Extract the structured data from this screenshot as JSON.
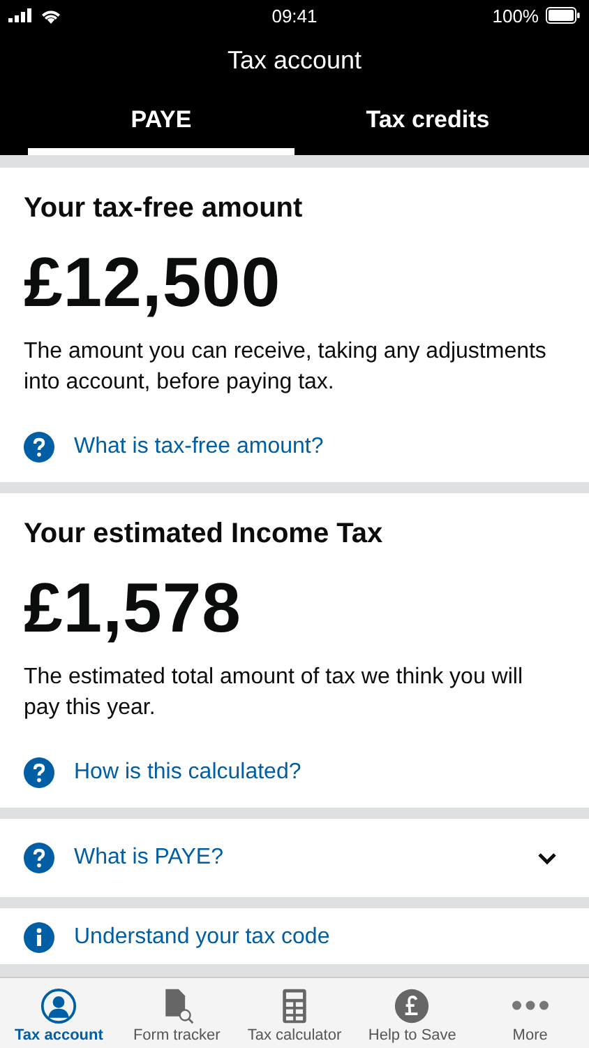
{
  "status_bar": {
    "time": "09:41",
    "battery": "100%"
  },
  "window": {
    "title": "Tax account"
  },
  "tabs": [
    {
      "label": "PAYE",
      "selected": true
    },
    {
      "label": "Tax credits",
      "selected": false
    }
  ],
  "cards": [
    {
      "heading": "Your tax-free amount",
      "amount": "£12,500",
      "description": "The amount you can receive, taking any adjustments into account, before paying tax.",
      "link": {
        "kind": "question",
        "label": "What is tax-free amount?"
      }
    },
    {
      "heading": "Your estimated Income Tax",
      "amount": "£1,578",
      "description": "The estimated total amount of tax we think you will pay this year.",
      "link": {
        "kind": "question",
        "label": "How is this calculated?"
      }
    }
  ],
  "expandable": {
    "kind": "question",
    "label": "What is PAYE?",
    "expanded": false
  },
  "info_link": {
    "kind": "info",
    "label": "Understand your tax code"
  },
  "tab_bar": [
    {
      "kind": "person",
      "label": "Tax account",
      "selected": true
    },
    {
      "kind": "form",
      "label": "Form tracker",
      "selected": false
    },
    {
      "kind": "calculator",
      "label": "Tax calculator",
      "selected": false
    },
    {
      "kind": "pound",
      "label": "Help to Save",
      "selected": false
    },
    {
      "kind": "more",
      "label": "More",
      "selected": false
    }
  ]
}
